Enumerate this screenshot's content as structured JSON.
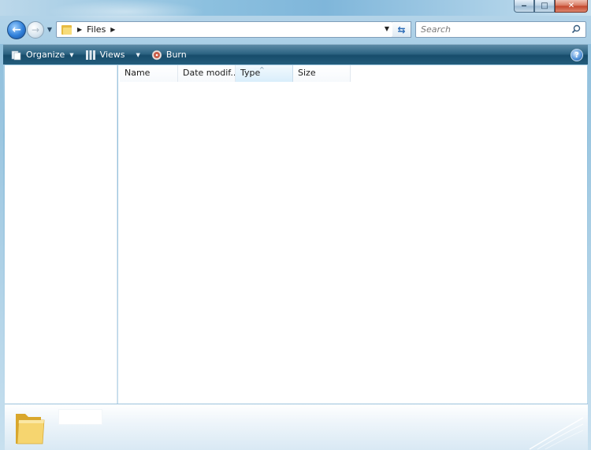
{
  "window": {
    "minimize_glyph": "‒",
    "maximize_glyph": "□",
    "close_glyph": "✕"
  },
  "navigation": {
    "back_glyph": "←",
    "forward_glyph": "→",
    "address": {
      "crumbs": [
        "Files"
      ],
      "icon": "folder-icon"
    },
    "search": {
      "placeholder": "Search",
      "value": ""
    }
  },
  "toolbar": {
    "organize_label": "Organize",
    "views_label": "Views",
    "burn_label": "Burn",
    "help_glyph": "?"
  },
  "file_list": {
    "columns": [
      {
        "label": "Name"
      },
      {
        "label": "Date modif..."
      },
      {
        "label": "Type",
        "sorted": true
      },
      {
        "label": "Size"
      }
    ],
    "rows": []
  },
  "details_pane": {
    "icon": "folder-icon"
  },
  "colors": {
    "toolbar": "#245d7c",
    "accent": "#2f7fd9",
    "folder": "#f7dc7a"
  }
}
